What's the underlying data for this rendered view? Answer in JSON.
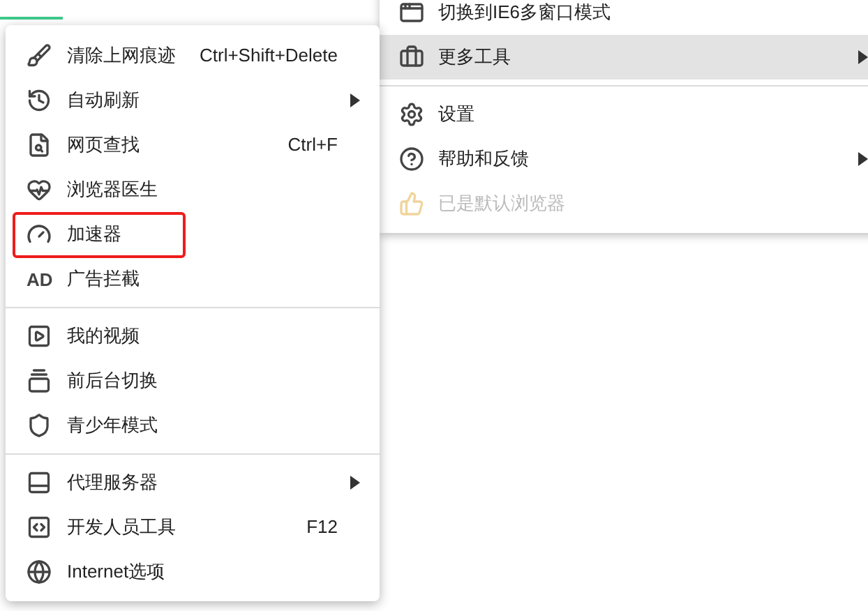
{
  "main_menu": {
    "groups": [
      [
        {
          "label": "切换到IE6多窗口模式",
          "selected": false,
          "disabled": false,
          "submenu": false
        },
        {
          "label": "更多工具",
          "selected": true,
          "disabled": false,
          "submenu": true
        }
      ],
      [
        {
          "label": "设置",
          "selected": false,
          "disabled": false,
          "submenu": false
        },
        {
          "label": "帮助和反馈",
          "selected": false,
          "disabled": false,
          "submenu": true
        },
        {
          "label": "已是默认浏览器",
          "selected": false,
          "disabled": true,
          "submenu": false
        }
      ]
    ]
  },
  "tools_submenu": {
    "groups": [
      [
        {
          "label": "清除上网痕迹",
          "shortcut": "Ctrl+Shift+Delete",
          "submenu": false,
          "highlighted": false
        },
        {
          "label": "自动刷新",
          "submenu": true,
          "highlighted": false
        },
        {
          "label": "网页查找",
          "shortcut": "Ctrl+F",
          "submenu": false,
          "highlighted": false
        },
        {
          "label": "浏览器医生",
          "submenu": false,
          "highlighted": false
        },
        {
          "label": "加速器",
          "submenu": false,
          "highlighted": true
        },
        {
          "label": "广告拦截",
          "icon_text": "AD",
          "submenu": false,
          "highlighted": false
        }
      ],
      [
        {
          "label": "我的视频",
          "submenu": false,
          "highlighted": false
        },
        {
          "label": "前后台切换",
          "submenu": false,
          "highlighted": false
        },
        {
          "label": "青少年模式",
          "submenu": false,
          "highlighted": false
        }
      ],
      [
        {
          "label": "代理服务器",
          "submenu": true,
          "highlighted": false
        },
        {
          "label": "开发人员工具",
          "shortcut": "F12",
          "submenu": false,
          "highlighted": false
        },
        {
          "label": "Internet选项",
          "submenu": false,
          "highlighted": false
        }
      ]
    ]
  }
}
